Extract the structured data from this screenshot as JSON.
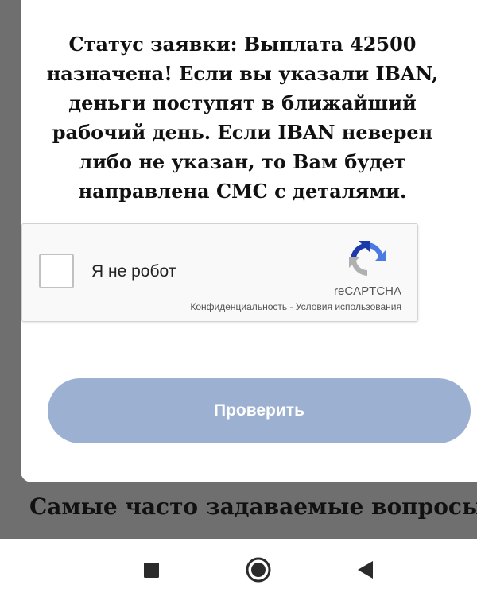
{
  "status": {
    "message": "Статус заявки: Выплата 42500 назначена! Если вы указали IBAN, деньги поступят в ближайший рабочий день. Если IBAN неверен либо не указан, то Вам будет направлена СМС с деталями."
  },
  "recaptcha": {
    "checkbox_label": "Я не робот",
    "brand": "reCAPTCHA",
    "privacy_link": "Конфиденциальность",
    "separator": " - ",
    "terms_link": "Условия использования",
    "logo_icon": "recaptcha-logo-icon"
  },
  "submit": {
    "label": "Проверить",
    "color": "#9cb0d2"
  },
  "faq": {
    "heading": "Самые часто задаваемые вопросы"
  },
  "navbar": {
    "icons": [
      "recents-square-icon",
      "home-circle-icon",
      "back-triangle-icon"
    ]
  }
}
